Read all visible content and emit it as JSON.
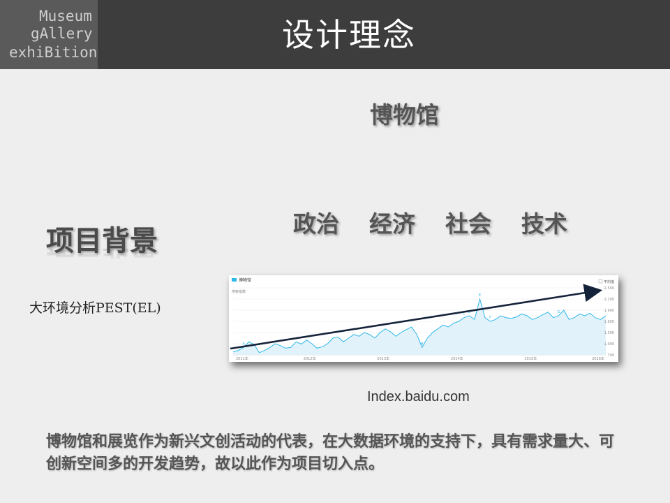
{
  "logo": {
    "line1": "Museum",
    "line2": "gAllery",
    "line3": "exhiBition",
    "line3_overlay": "B"
  },
  "header": {
    "title": "设计理念"
  },
  "museum_label": "博物馆",
  "pest_factors": "政治  经济  社会  技术",
  "project": {
    "title": "项目背景",
    "subtitle": "大环境分析PEST(EL)"
  },
  "chart_data": {
    "type": "line",
    "legend": "博物馆",
    "subheading": "搜索指数",
    "avg_label": "平均值",
    "x_ticks": [
      "2011年",
      "2012年",
      "2013年",
      "2014年",
      "2015年",
      "2016年"
    ],
    "y_ticks": [
      "2,500",
      "2,200",
      "1,900",
      "1,600",
      "1,300",
      "1,000",
      "700"
    ],
    "ylim": [
      700,
      2500
    ],
    "grid": true,
    "series": [
      {
        "name": "博物馆",
        "values": [
          780,
          820,
          900,
          1050,
          980,
          760,
          820,
          900,
          1000,
          950,
          880,
          900,
          1050,
          990,
          1100,
          1000,
          880,
          920,
          1000,
          1150,
          1180,
          1050,
          1150,
          1250,
          1200,
          1300,
          1250,
          1150,
          1300,
          1400,
          1320,
          1200,
          1300,
          1380,
          1450,
          1250,
          900,
          1150,
          1300,
          1400,
          1500,
          1450,
          1550,
          1600,
          1700,
          1750,
          1650,
          2200,
          1700,
          1600,
          1650,
          1750,
          1700,
          1680,
          1720,
          1800,
          1750,
          1650,
          1700,
          1780,
          1850,
          1700,
          1750,
          1900,
          1650,
          1700,
          1800,
          1750,
          1820,
          1700,
          1650,
          1750
        ]
      }
    ],
    "annotations": [
      "B",
      "C",
      "D",
      "E",
      "F",
      "G",
      "A"
    ],
    "trend": "increasing"
  },
  "source": "Index.baidu.com",
  "body_text": "博物馆和展览作为新兴文创活动的代表，在大数据环境的支持下，具有需求量大、可创新空间多的开发趋势，故以此作为项目切入点。",
  "colors": {
    "header_bg": "#3d3d3d",
    "logo_bg": "#5a5a5a",
    "series_line": "#2db7e8",
    "area_fill": "#e1f2fa",
    "trend_arrow": "#14233a"
  }
}
